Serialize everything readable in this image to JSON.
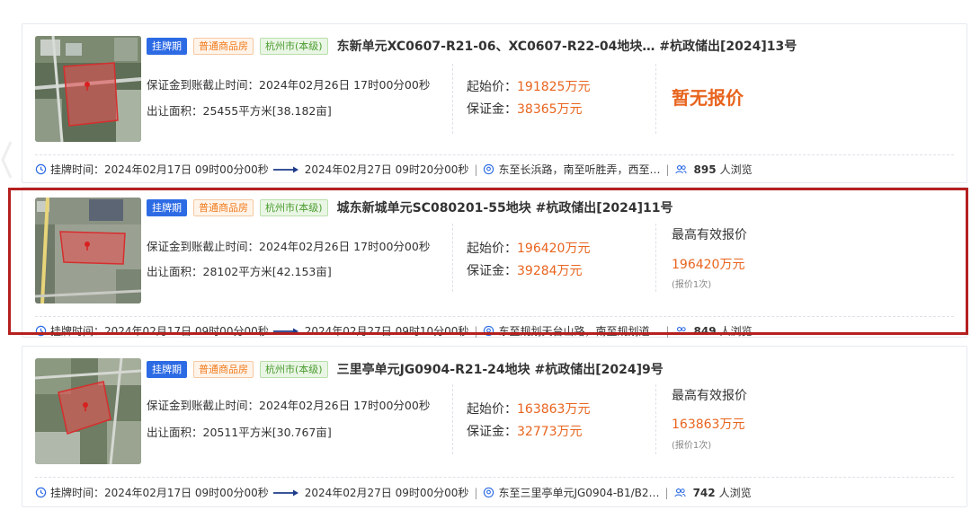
{
  "listings": [
    {
      "tags": {
        "status": "挂牌期",
        "type": "普通商品房",
        "city": "杭州市(本级)"
      },
      "title": "东新单元XC0607-R21-06、XC0607-R22-04地块…  #杭政储出[2024]13号",
      "deposit_deadline": "保证金到账截止时间：2024年02月26日 17时00分00秒",
      "area": "出让面积：25455平方米[38.182亩]",
      "start_price_label": "起始价：",
      "start_price": "191825万元",
      "deposit_label": "保证金：",
      "deposit": "38365万元",
      "bid_status": "暂无报价",
      "listing_time_label": "挂牌时间：",
      "listing_start": "2024年02月17日 09时00分00秒",
      "listing_end": "2024年02月27日 09时20分00秒",
      "location": "东至长浜路，南至听胜弄，西至…",
      "views_count": "895",
      "views_label": "人浏览"
    },
    {
      "tags": {
        "status": "挂牌期",
        "type": "普通商品房",
        "city": "杭州市(本级)"
      },
      "title": "城东新城单元SC080201-55地块  #杭政储出[2024]11号",
      "deposit_deadline": "保证金到账截止时间：2024年02月26日 17时00分00秒",
      "area": "出让面积：28102平方米[42.153亩]",
      "start_price_label": "起始价：",
      "start_price": "196420万元",
      "deposit_label": "保证金：",
      "deposit": "39284万元",
      "bid_label": "最高有效报价",
      "bid_value": "196420万元",
      "bid_count": "(报价1次)",
      "listing_time_label": "挂牌时间：",
      "listing_start": "2024年02月17日 09时00分00秒",
      "listing_end": "2024年02月27日 09时10分00秒",
      "location": "东至规划天台山路，南至规划道…",
      "views_count": "849",
      "views_label": "人浏览"
    },
    {
      "tags": {
        "status": "挂牌期",
        "type": "普通商品房",
        "city": "杭州市(本级)"
      },
      "title": "三里亭单元JG0904-R21-24地块  #杭政储出[2024]9号",
      "deposit_deadline": "保证金到账截止时间：2024年02月26日 17时00分00秒",
      "area": "出让面积：20511平方米[30.767亩]",
      "start_price_label": "起始价：",
      "start_price": "163863万元",
      "deposit_label": "保证金：",
      "deposit": "32773万元",
      "bid_label": "最高有效报价",
      "bid_value": "163863万元",
      "bid_count": "(报价1次)",
      "listing_time_label": "挂牌时间：",
      "listing_start": "2024年02月17日 09时00分00秒",
      "listing_end": "2024年02月27日 09时00分00秒",
      "location": "东至三里亭单元JG0904-B1/B2…",
      "views_count": "742",
      "views_label": "人浏览"
    }
  ],
  "colors": {
    "accent_blue": "#2d6be4",
    "price_orange": "#e8641e",
    "highlight_red": "#b5201f"
  },
  "icons": [
    "clock-icon",
    "arrow-right-icon",
    "location-icon",
    "users-icon",
    "map-pin-icon"
  ]
}
